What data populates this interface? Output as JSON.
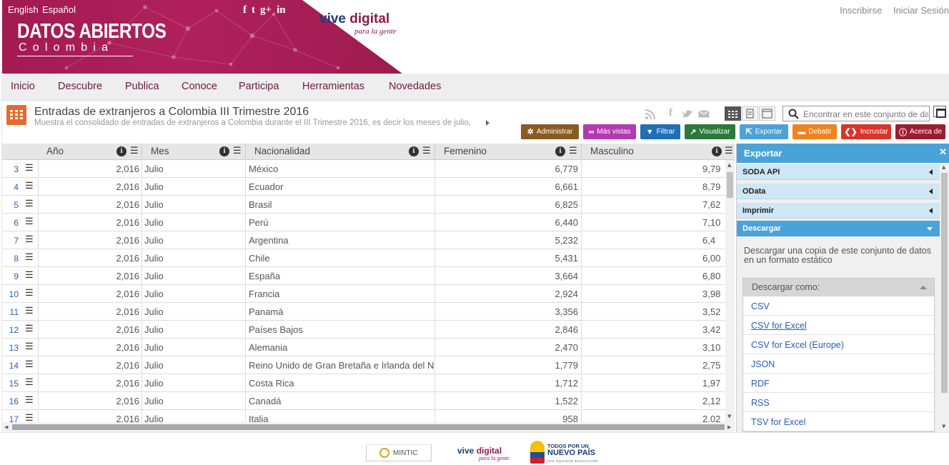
{
  "header": {
    "lang_en": "English",
    "lang_es": "Español",
    "social_icons": [
      "facebook-icon",
      "twitter-icon",
      "google-plus-icon",
      "linkedin-icon"
    ],
    "logo_title": "DATOS ABIERTOS",
    "logo_subtitle": "Colombia",
    "vive_brand_1": "vive",
    "vive_brand_2": "digital",
    "vive_tagline": "para la gente",
    "signup": "Inscribirse",
    "login": "Iniciar Sesión",
    "brand_color": "#a21a52"
  },
  "nav": {
    "items": [
      "Inicio",
      "Descubre",
      "Publica",
      "Conoce",
      "Participa",
      "Herramientas",
      "Novedades"
    ]
  },
  "dataset": {
    "title": "Entradas de extranjeros a Colombia III Trimestre 2016",
    "description": "Muestra el consolidado de entradas de extranjeros a Colombia durante el III Trimestre 2016, es decir los meses de julio,",
    "search_placeholder": "Encontrar en este conjunto de datos",
    "actions": [
      {
        "label": "Administrar",
        "icon": "gear-icon",
        "color": "#8a5a23"
      },
      {
        "label": "Más vistas",
        "icon": "glasses-icon",
        "color": "#b23ab2"
      },
      {
        "label": "Filtrar",
        "icon": "filter-icon",
        "color": "#1f6fb5"
      },
      {
        "label": "Visualizar",
        "icon": "chart-icon",
        "color": "#2a7a3a"
      },
      {
        "label": "Exportar",
        "icon": "export-icon",
        "color": "#4aa3d8"
      },
      {
        "label": "Debatir",
        "icon": "speech-icon",
        "color": "#f0831e"
      },
      {
        "label": "Incrustar",
        "icon": "code-icon",
        "color": "#d8342c"
      },
      {
        "label": "Acerca de",
        "icon": "info-icon",
        "color": "#9c1d30"
      }
    ]
  },
  "grid": {
    "columns": [
      "Año",
      "Mes",
      "Nacionalidad",
      "Femenino",
      "Masculino"
    ],
    "rows": [
      {
        "n": "3",
        "anio": "2,016",
        "mes": "Julio",
        "nac": "México",
        "fem": "6,779",
        "mas": "9,79"
      },
      {
        "n": "4",
        "anio": "2,016",
        "mes": "Julio",
        "nac": "Ecuador",
        "fem": "6,661",
        "mas": "8,79"
      },
      {
        "n": "5",
        "anio": "2,016",
        "mes": "Julio",
        "nac": "Brasil",
        "fem": "6,825",
        "mas": "7,62"
      },
      {
        "n": "6",
        "anio": "2,016",
        "mes": "Julio",
        "nac": "Perú",
        "fem": "6,440",
        "mas": "7,10"
      },
      {
        "n": "7",
        "anio": "2,016",
        "mes": "Julio",
        "nac": "Argentina",
        "fem": "5,232",
        "mas": "6,4"
      },
      {
        "n": "8",
        "anio": "2,016",
        "mes": "Julio",
        "nac": "Chile",
        "fem": "5,431",
        "mas": "6,00"
      },
      {
        "n": "9",
        "anio": "2,016",
        "mes": "Julio",
        "nac": "España",
        "fem": "3,664",
        "mas": "6,80"
      },
      {
        "n": "10",
        "anio": "2,016",
        "mes": "Julio",
        "nac": "Francia",
        "fem": "2,924",
        "mas": "3,98"
      },
      {
        "n": "11",
        "anio": "2,016",
        "mes": "Julio",
        "nac": "Panamá",
        "fem": "3,356",
        "mas": "3,52"
      },
      {
        "n": "12",
        "anio": "2,016",
        "mes": "Julio",
        "nac": "Países Bajos",
        "fem": "2,846",
        "mas": "3,42"
      },
      {
        "n": "13",
        "anio": "2,016",
        "mes": "Julio",
        "nac": "Alemania",
        "fem": "2,470",
        "mas": "3,10"
      },
      {
        "n": "14",
        "anio": "2,016",
        "mes": "Julio",
        "nac": "Reino Unido de Gran Bretaña e Irlanda del Nor",
        "fem": "1,779",
        "mas": "2,75"
      },
      {
        "n": "15",
        "anio": "2,016",
        "mes": "Julio",
        "nac": "Costa Rica",
        "fem": "1,712",
        "mas": "1,97"
      },
      {
        "n": "16",
        "anio": "2,016",
        "mes": "Julio",
        "nac": "Canadá",
        "fem": "1,522",
        "mas": "2,12"
      },
      {
        "n": "17",
        "anio": "2,016",
        "mes": "Julio",
        "nac": "Italia",
        "fem": "958",
        "mas": "2,02"
      }
    ]
  },
  "panel": {
    "title": "Exportar",
    "sections": [
      "SODA API",
      "OData",
      "Imprimir",
      "Descargar"
    ],
    "download_desc": "Descargar una copia de este conjunto de datos en un formato estático",
    "download_as": "Descargar como:",
    "formats": [
      "CSV",
      "CSV for Excel",
      "CSV for Excel (Europe)",
      "JSON",
      "RDF",
      "RSS",
      "TSV for Excel"
    ],
    "accent": "#4aa3d8"
  },
  "footer": {
    "mintic": "MINTIC",
    "vive_1": "vive",
    "vive_2": "digital",
    "vive_tagline": "para la gente",
    "todos_1": "TODOS POR UN",
    "todos_2": "NUEVO PAÍS",
    "todos_3": "PAZ  EQUIDAD  EDUCACIÓN"
  }
}
